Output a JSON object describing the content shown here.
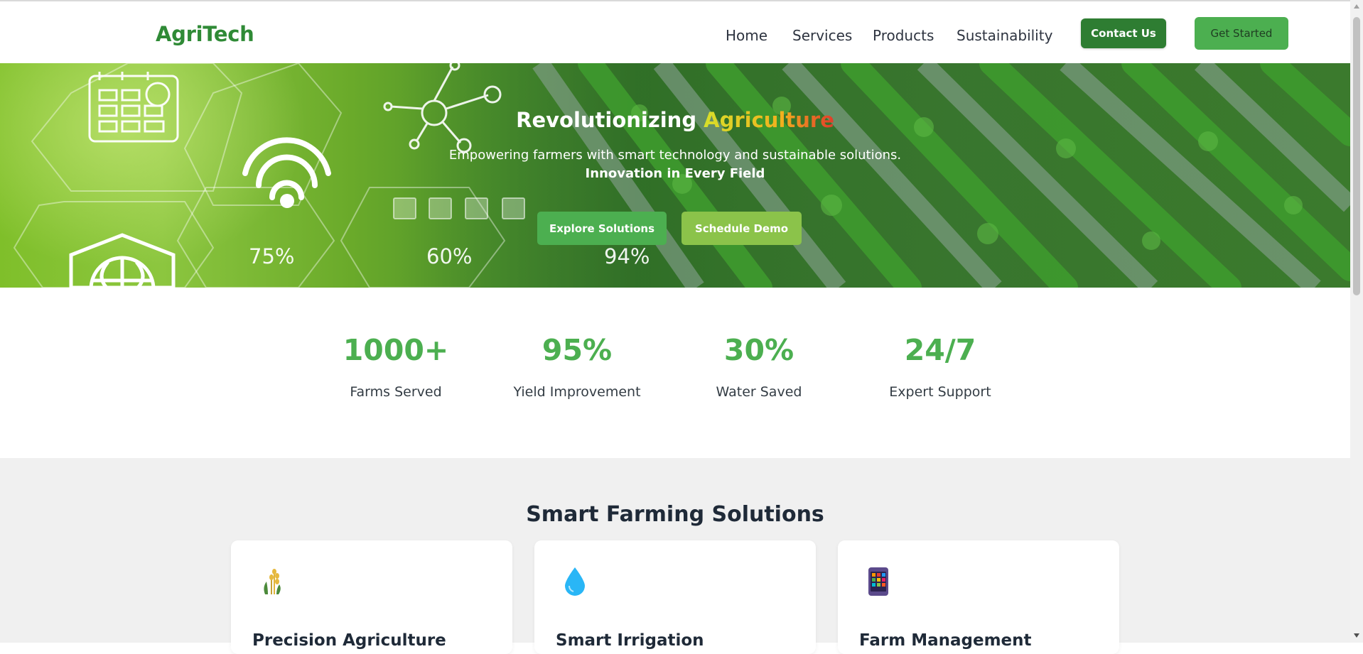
{
  "nav": {
    "logo": "AgriTech",
    "links": [
      "Home",
      "Services",
      "Products",
      "Sustainability"
    ],
    "contact_label": "Contact Us",
    "start_label": "Get Started"
  },
  "hero": {
    "title_prefix": "Revolutionizing ",
    "title_accent": "Agriculture",
    "subtitle": "Empowering farmers with smart technology and sustainable solutions.",
    "tagline": "Innovation in Every Field",
    "explore_label": "Explore Solutions",
    "demo_label": "Schedule Demo",
    "overlay_percentages": [
      "75%",
      "60%",
      "94%"
    ]
  },
  "stats": [
    {
      "value": "1000+",
      "label": "Farms Served"
    },
    {
      "value": "95%",
      "label": "Yield Improvement"
    },
    {
      "value": "30%",
      "label": "Water Saved"
    },
    {
      "value": "24/7",
      "label": "Expert Support"
    }
  ],
  "solutions": {
    "title": "Smart Farming Solutions",
    "cards": [
      {
        "title": "Precision Agriculture",
        "icon": "wheat-icon"
      },
      {
        "title": "Smart Irrigation",
        "icon": "water-drop-icon"
      },
      {
        "title": "Farm Management",
        "icon": "mobile-app-icon"
      }
    ]
  },
  "colors": {
    "brand_dark": "#2e7d32",
    "brand": "#4caf50",
    "brand_light": "#8bc34a",
    "section_bg": "#f0f0f0"
  }
}
